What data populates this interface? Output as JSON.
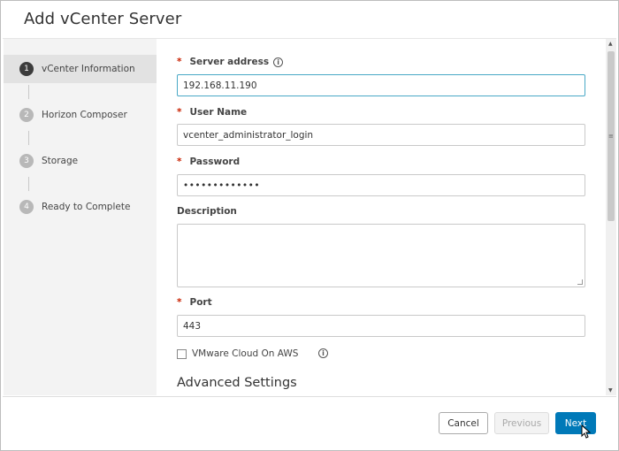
{
  "dialog": {
    "title": "Add vCenter Server"
  },
  "steps": [
    {
      "num": "1",
      "label": "vCenter Information"
    },
    {
      "num": "2",
      "label": "Horizon Composer"
    },
    {
      "num": "3",
      "label": "Storage"
    },
    {
      "num": "4",
      "label": "Ready to Complete"
    }
  ],
  "form": {
    "server_address": {
      "label": "Server address",
      "value": "192.168.11.190"
    },
    "user_name": {
      "label": "User Name",
      "value": "vcenter_administrator_login"
    },
    "password": {
      "label": "Password",
      "value": "•••••••••••••"
    },
    "description": {
      "label": "Description",
      "value": ""
    },
    "port": {
      "label": "Port",
      "value": "443"
    },
    "vmware_cloud": {
      "label": "VMware Cloud On AWS"
    },
    "advanced_title": "Advanced Settings",
    "required_marker": "*",
    "info_glyph": "i"
  },
  "buttons": {
    "cancel": "Cancel",
    "previous": "Previous",
    "next": "Next"
  },
  "colors": {
    "primary": "#0079b8",
    "required": "#c92100",
    "focus": "#49a8c6"
  }
}
